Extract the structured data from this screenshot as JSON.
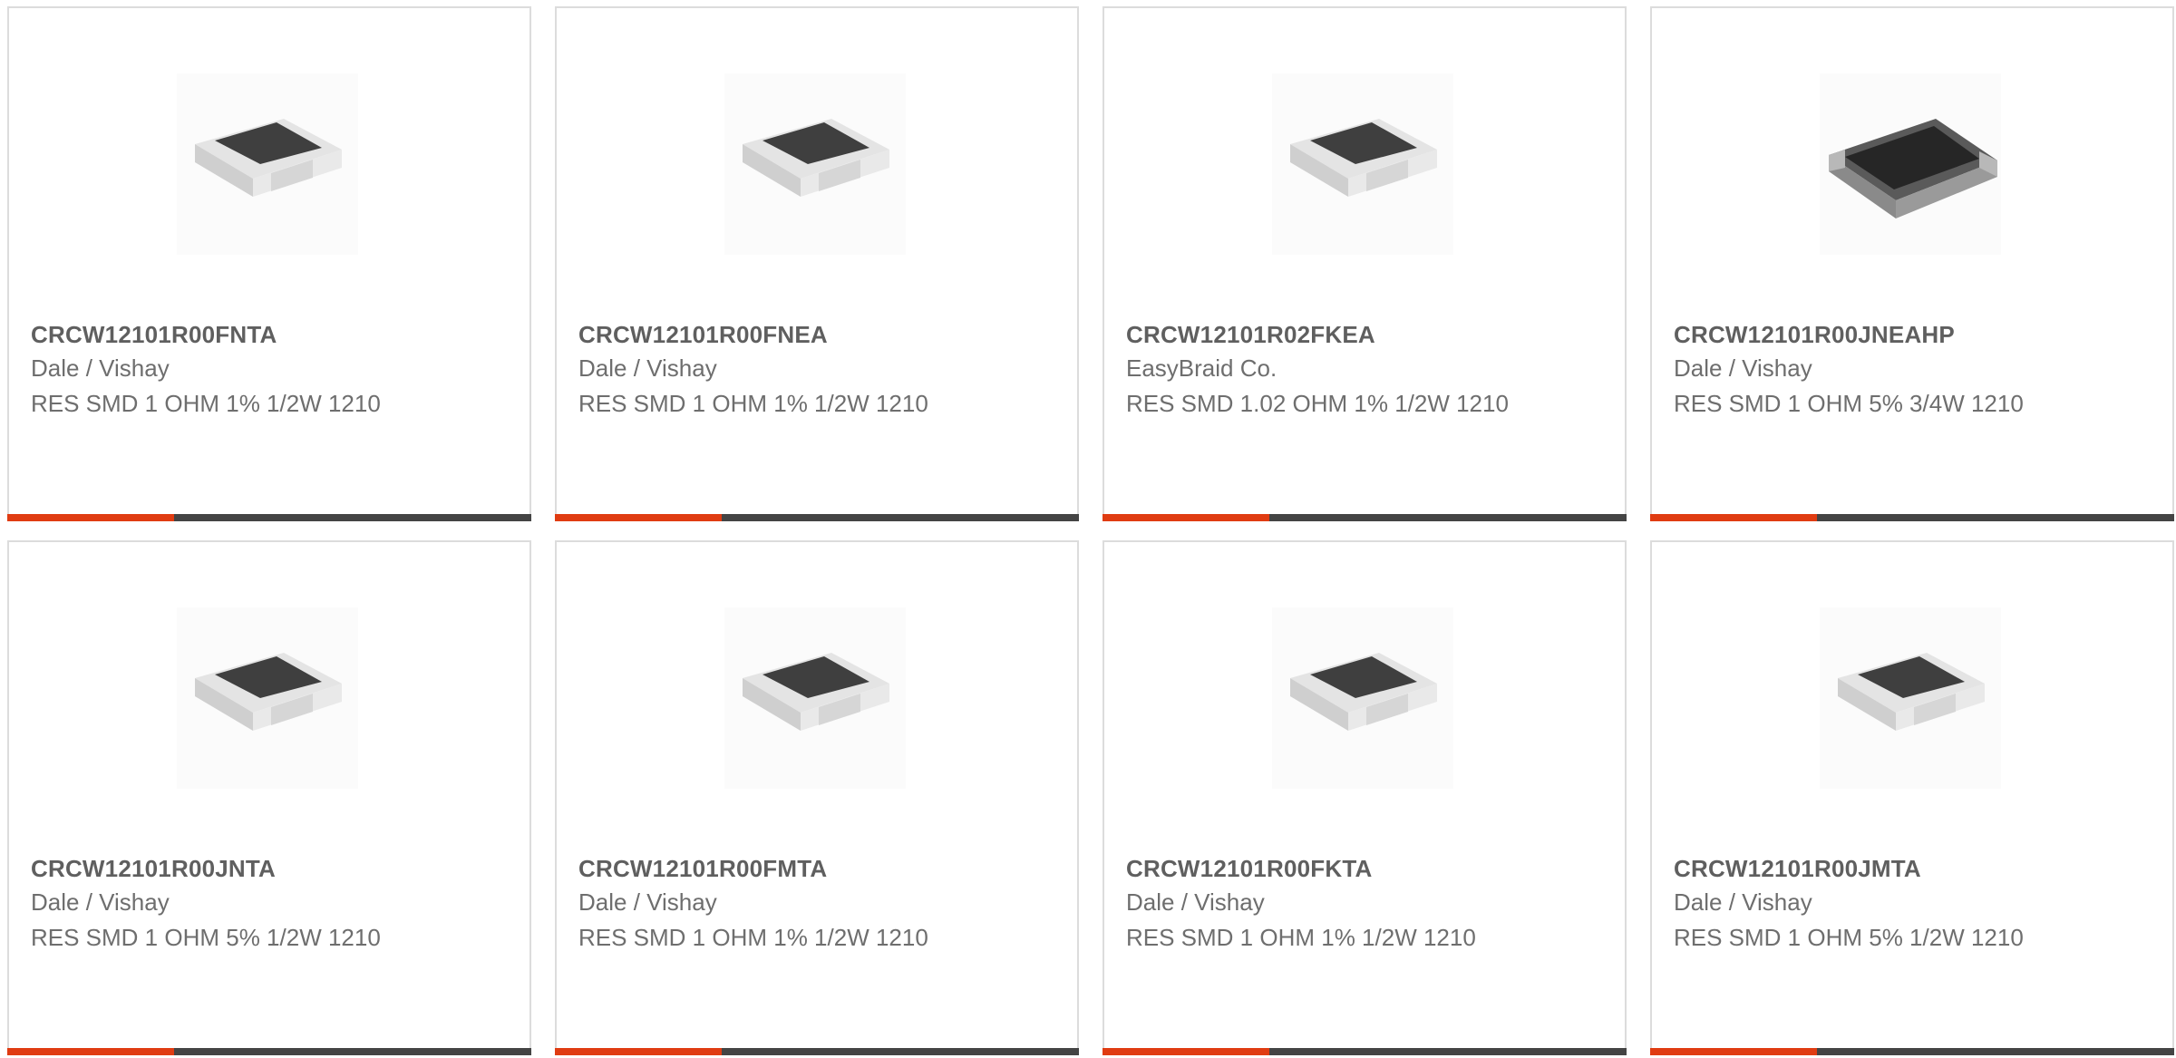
{
  "colors": {
    "accent": "#e03c12",
    "bar_dark": "#444444",
    "border": "#dcdcdc"
  },
  "products": [
    {
      "part_number": "CRCW12101R00FNTA",
      "manufacturer": "Dale / Vishay",
      "description": "RES SMD 1 OHM 1% 1/2W 1210",
      "image": "resistor-chip-image"
    },
    {
      "part_number": "CRCW12101R00FNEA",
      "manufacturer": "Dale / Vishay",
      "description": "RES SMD 1 OHM 1% 1/2W 1210",
      "image": "resistor-chip-image"
    },
    {
      "part_number": "CRCW12101R02FKEA",
      "manufacturer": "EasyBraid Co.",
      "description": "RES SMD 1.02 OHM 1% 1/2W 1210",
      "image": "resistor-chip-image"
    },
    {
      "part_number": "CRCW12101R00JNEAHP",
      "manufacturer": "Dale / Vishay",
      "description": "RES SMD 1 OHM 5% 3/4W 1210",
      "image": "resistor-chip-dark-image"
    },
    {
      "part_number": "CRCW12101R00JNTA",
      "manufacturer": "Dale / Vishay",
      "description": "RES SMD 1 OHM 5% 1/2W 1210",
      "image": "resistor-chip-image"
    },
    {
      "part_number": "CRCW12101R00FMTA",
      "manufacturer": "Dale / Vishay",
      "description": "RES SMD 1 OHM 1% 1/2W 1210",
      "image": "resistor-chip-image"
    },
    {
      "part_number": "CRCW12101R00FKTA",
      "manufacturer": "Dale / Vishay",
      "description": "RES SMD 1 OHM 1% 1/2W 1210",
      "image": "resistor-chip-image"
    },
    {
      "part_number": "CRCW12101R00JMTA",
      "manufacturer": "Dale / Vishay",
      "description": "RES SMD 1 OHM 5% 1/2W 1210",
      "image": "resistor-chip-image"
    }
  ]
}
